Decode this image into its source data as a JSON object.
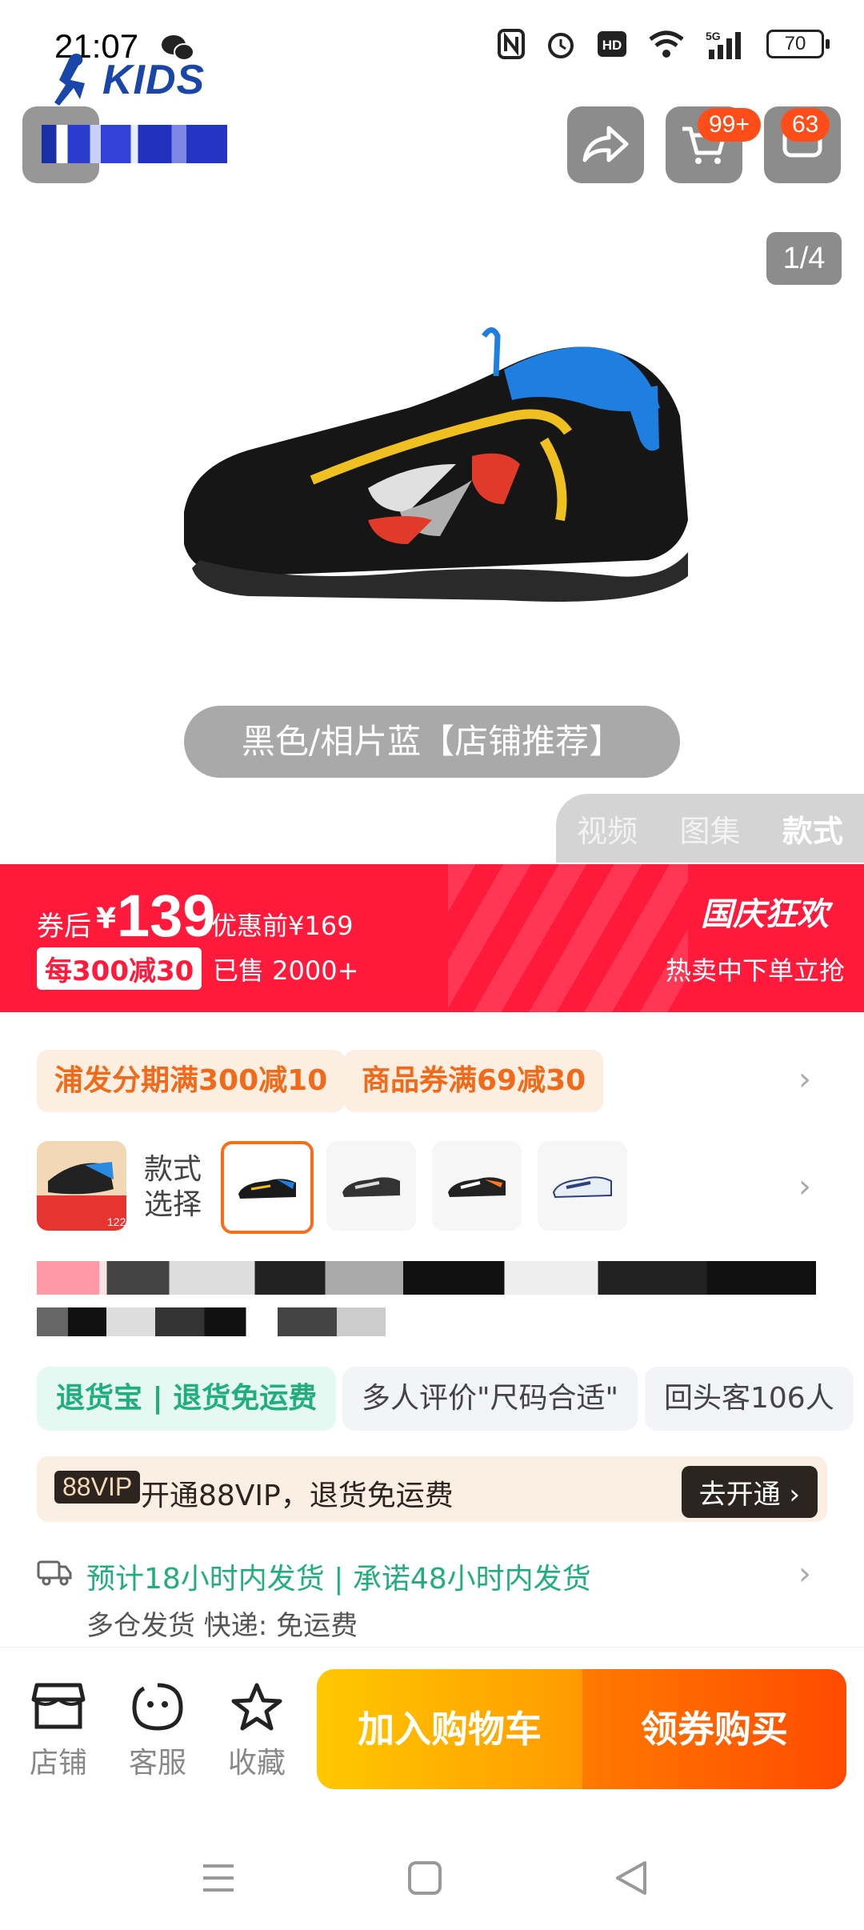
{
  "status_bar": {
    "time": "21:07",
    "battery": "70",
    "network": "5G"
  },
  "header": {
    "brand_logo_text": "KIDS",
    "cart_badge": "99+",
    "message_badge": "63"
  },
  "gallery": {
    "counter": "1/4",
    "variant_label": "黑色/相片蓝【店铺推荐】",
    "tabs": [
      "视频",
      "图集",
      "款式"
    ]
  },
  "price": {
    "after_coupon_label": "券后",
    "currency": "¥",
    "value": "139",
    "original": "优惠前¥169",
    "promo": "每300减30",
    "sold": "已售 2000+",
    "event_title": "国庆狂欢",
    "event_sub": "热卖中下单立抢"
  },
  "coupons": [
    "浦发分期满300减10",
    "商品券满69减30"
  ],
  "style_picker": {
    "label_line1": "款式",
    "label_line2": "选择",
    "thumb_price": "122"
  },
  "tags": [
    "退货宝 | 退货免运费",
    "多人评价\"尺码合适\"",
    "回头客106人"
  ],
  "vip": {
    "badge": "88VIP",
    "text": "开通88VIP，退货免运费",
    "button": "去开通 ›"
  },
  "shipping": {
    "line1": "预计18小时内发货 | 承诺48小时内发货",
    "line2": "多仓发货  快递:  免运费"
  },
  "bottom_bar": {
    "shop": "店铺",
    "service": "客服",
    "favorite": "收藏",
    "add_cart": "加入购物车",
    "buy": "领券购买"
  },
  "colors": {
    "accent_red": "#ff1a3c",
    "orange": "#ff6a1a",
    "green": "#1fae7c"
  }
}
